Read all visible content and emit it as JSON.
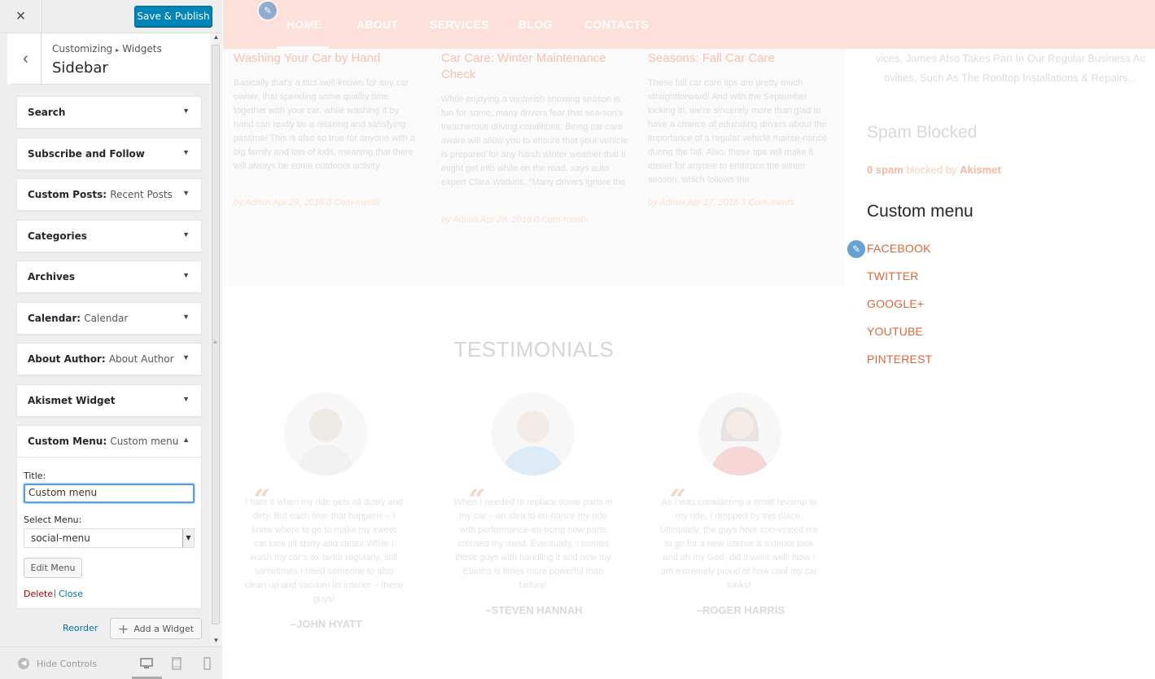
{
  "panel": {
    "close_icon": "×",
    "publish_label": "Save & Publish",
    "back_icon": "‹",
    "breadcrumb_root": "Customizing",
    "breadcrumb_sep": "▸",
    "breadcrumb_child": "Widgets",
    "section_title": "Sidebar",
    "widgets": [
      {
        "title": "Search",
        "sub": ""
      },
      {
        "title": "Subscribe and Follow",
        "sub": ""
      },
      {
        "title": "Custom Posts:",
        "sub": "Recent Posts"
      },
      {
        "title": "Categories",
        "sub": ""
      },
      {
        "title": "Archives",
        "sub": ""
      },
      {
        "title": "Calendar:",
        "sub": "Calendar"
      },
      {
        "title": "About Author:",
        "sub": "About Author"
      },
      {
        "title": "Akismet Widget",
        "sub": ""
      }
    ],
    "open_widget": {
      "title": "Custom Menu:",
      "sub": "Custom menu",
      "title_label": "Title:",
      "title_value": "Custom menu",
      "select_label": "Select Menu:",
      "select_value": "social-menu",
      "edit_menu": "Edit Menu",
      "delete": "Delete",
      "pipe": "|",
      "close": "Close"
    },
    "reorder": "Reorder",
    "add_widget": "Add a Widget",
    "hide_controls": "Hide Controls"
  },
  "preview": {
    "nav": [
      "HOME",
      "ABOUT",
      "SERVICES",
      "BLOG",
      "CONTACTS"
    ],
    "posts": [
      {
        "title": "Washing Your Car by Hand",
        "body": "Basically that’s a fact well-known for any car owner, that spending some quality time together with your car, while washing it by hand can really be a relaxing and satisfying pastime! This is also so true for anyone with a big family and lots of kids, meaning that there will always be some outdoors activity",
        "meta": "by Admin      Apr 29, 2016      0 Com-ments"
      },
      {
        "title": "Car Care: Winter Maintenance Check",
        "body": "While enjoying a winterish snowing season is fun for some, many drivers fear that sea-son’s treacherous driving conditions. Being car care aware will allow you to ensure that your vehicle is prepared for any harsh winter weather that it might get into while on the road, says auto expert Clara Watkins. “Many drivers ignore the",
        "meta": "by Admin      Apr 28, 2016      0 Com-ments"
      },
      {
        "title": "Seasons: Fall Car Care",
        "body": "These fall car care tips are pretty much straightforward! And with the September kicking in, we’re sincerely more than glad to have a chance of educating drivers about the importance of a regular vehicle mainte-nance during the fall. Also, these tips will make it easier for anyone to embrace the winter season, which follows the",
        "meta": "by Admin      Apr 27, 2016      3 Com-ments"
      }
    ],
    "sidebar_text": "vices, James Also Takes Part In Our Regular Business Ac tivities, Such As The Rooftop Installations & Repairs...",
    "spam_title": "Spam Blocked",
    "spam_count": "0 spam",
    "spam_mid": "blocked by",
    "spam_by": "Akismet",
    "custom_menu_title": "Custom menu",
    "custom_menu_items": [
      "FACEBOOK",
      "TWITTER",
      "GOOGLE+",
      "YOUTUBE",
      "PINTEREST"
    ],
    "testimonials_title": "TESTIMONIALS",
    "testimonials": [
      {
        "quote": "I hate it when my ride gets all dusty and dirty. But each time that happens – I know where to go to make my sweet car look all shiny and clean! While I wash my car’s ex-terior regularly, still sometimes I need someone to also clean up and vacuum its interior – these guys!",
        "name": "–JOHN HYATT"
      },
      {
        "quote": "When I needed to replace some parts in my car – an idea to en-hance my ride with performance-en-ticing new parts crossed my mind. Eventually, I trusted these guys with handling it and now my Elantra is times more powerful than before!",
        "name": "–STEVEN HANNAH"
      },
      {
        "quote": "As I was considering a small revamp to my ride, I dropped by this place. Ultimately, the guys here con-vinced me to go for a new interior & exterior look and oh my God, did it went well! Now I am extremely proud of how cool my car looks!",
        "name": "–ROGER HARRIS"
      }
    ]
  }
}
